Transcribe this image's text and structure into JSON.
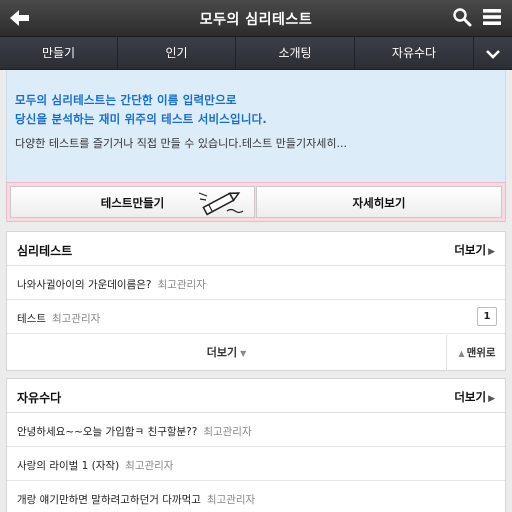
{
  "header": {
    "title": "모두의 심리테스트"
  },
  "nav": {
    "tabs": [
      "만들기",
      "인기",
      "소개팅",
      "자유수다"
    ]
  },
  "intro": {
    "line1": "모두의 심리테스트는 간단한 이름 입력만으로",
    "line2": "당신을 분석하는 재미 위주의 테스트 서비스입니다.",
    "desc": "다양한 테스트를 즐기거나 직접 만들 수 있습니다.테스트 만들기자세히..."
  },
  "buttons": {
    "make": "테스트만들기",
    "detail": "자세히보기"
  },
  "psych": {
    "title": "심리테스트",
    "more": "더보기",
    "items": [
      {
        "title": "나와사귈아이의 가운데이름은?",
        "author": "최고관리자",
        "count": ""
      },
      {
        "title": "테스트",
        "author": "최고관리자",
        "count": "1"
      }
    ],
    "load_more": "더보기",
    "to_top": "맨위로"
  },
  "free": {
    "title": "자유수다",
    "more": "더보기",
    "items": [
      {
        "title": "안녕하세요~~오늘 가입함ㅋ 친구할분??",
        "author": "최고관리자"
      },
      {
        "title": "사랑의 라이벌 1 (자작)",
        "author": "최고관리자"
      },
      {
        "title": "개랑 얘기만하면 말하려고하던거 다까먹고",
        "author": "최고관리자"
      }
    ]
  },
  "icons": [
    "back-arrow-icon",
    "search-icon",
    "menu-icon",
    "chevron-down-icon",
    "pencil-icon",
    "triangle-right-icon",
    "triangle-down-icon",
    "triangle-up-icon"
  ]
}
